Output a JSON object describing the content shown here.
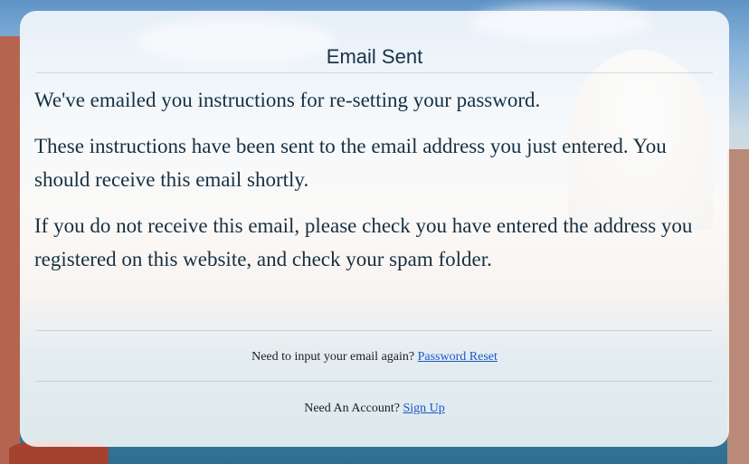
{
  "card": {
    "title": "Email Sent",
    "paragraphs": [
      "We've emailed you instructions for re-setting your password.",
      "These instructions have been sent to the email address you just entered. You should receive this email shortly.",
      "If you do not receive this email, please check you have entered the address you registered on this website, and check your spam folder."
    ]
  },
  "footer": {
    "reset_prompt": "Need to input your email again? ",
    "reset_link": "Password Reset",
    "signup_prompt": "Need An Account? ",
    "signup_link": "Sign Up"
  },
  "colors": {
    "title_text": "#1b3246",
    "link": "#1a57c8"
  }
}
